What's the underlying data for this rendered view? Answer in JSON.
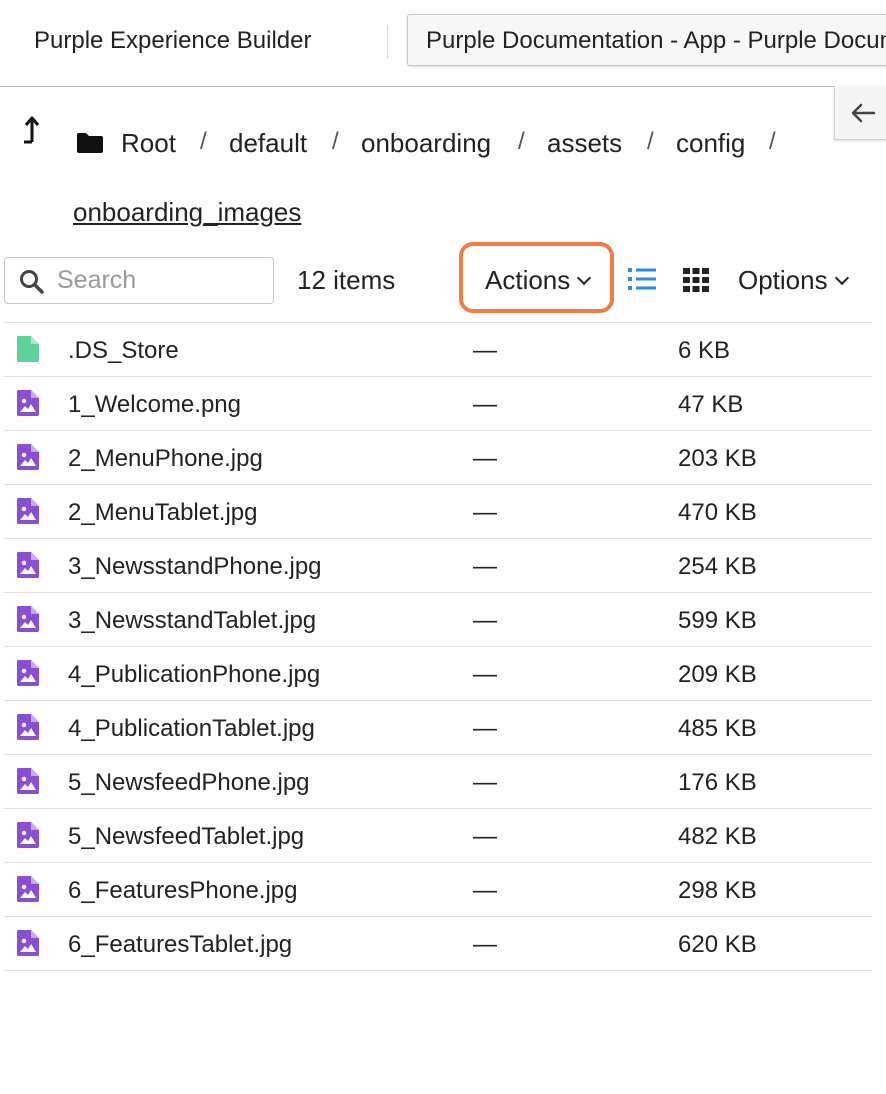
{
  "header": {
    "app_title": "Purple Experience Builder",
    "app_selector": "Purple Documentation - App - Purple Documentation"
  },
  "breadcrumb": {
    "items": [
      "Root",
      "default",
      "onboarding",
      "assets",
      "config"
    ],
    "separator": "/",
    "current": "onboarding_images"
  },
  "toolbar": {
    "search_placeholder": "Search",
    "item_count": "12 items",
    "actions_label": "Actions",
    "options_label": "Options",
    "highlight_color": "#f47b45",
    "list_view_color": "#2a8ae8"
  },
  "files": [
    {
      "name": ".DS_Store",
      "modified": "—",
      "size": "6 KB",
      "icon": "generic-file-icon"
    },
    {
      "name": "1_Welcome.png",
      "modified": "—",
      "size": "47 KB",
      "icon": "image-file-icon"
    },
    {
      "name": "2_MenuPhone.jpg",
      "modified": "—",
      "size": "203 KB",
      "icon": "image-file-icon"
    },
    {
      "name": "2_MenuTablet.jpg",
      "modified": "—",
      "size": "470 KB",
      "icon": "image-file-icon"
    },
    {
      "name": "3_NewsstandPhone.jpg",
      "modified": "—",
      "size": "254 KB",
      "icon": "image-file-icon"
    },
    {
      "name": "3_NewsstandTablet.jpg",
      "modified": "—",
      "size": "599 KB",
      "icon": "image-file-icon"
    },
    {
      "name": "4_PublicationPhone.jpg",
      "modified": "—",
      "size": "209 KB",
      "icon": "image-file-icon"
    },
    {
      "name": "4_PublicationTablet.jpg",
      "modified": "—",
      "size": "485 KB",
      "icon": "image-file-icon"
    },
    {
      "name": "5_NewsfeedPhone.jpg",
      "modified": "—",
      "size": "176 KB",
      "icon": "image-file-icon"
    },
    {
      "name": "5_NewsfeedTablet.jpg",
      "modified": "—",
      "size": "482 KB",
      "icon": "image-file-icon"
    },
    {
      "name": "6_FeaturesPhone.jpg",
      "modified": "—",
      "size": "298 KB",
      "icon": "image-file-icon"
    },
    {
      "name": "6_FeaturesTablet.jpg",
      "modified": "—",
      "size": "620 KB",
      "icon": "image-file-icon"
    }
  ],
  "colors": {
    "generic_file": "#5fd39a",
    "image_file": "#8a4fd0"
  }
}
